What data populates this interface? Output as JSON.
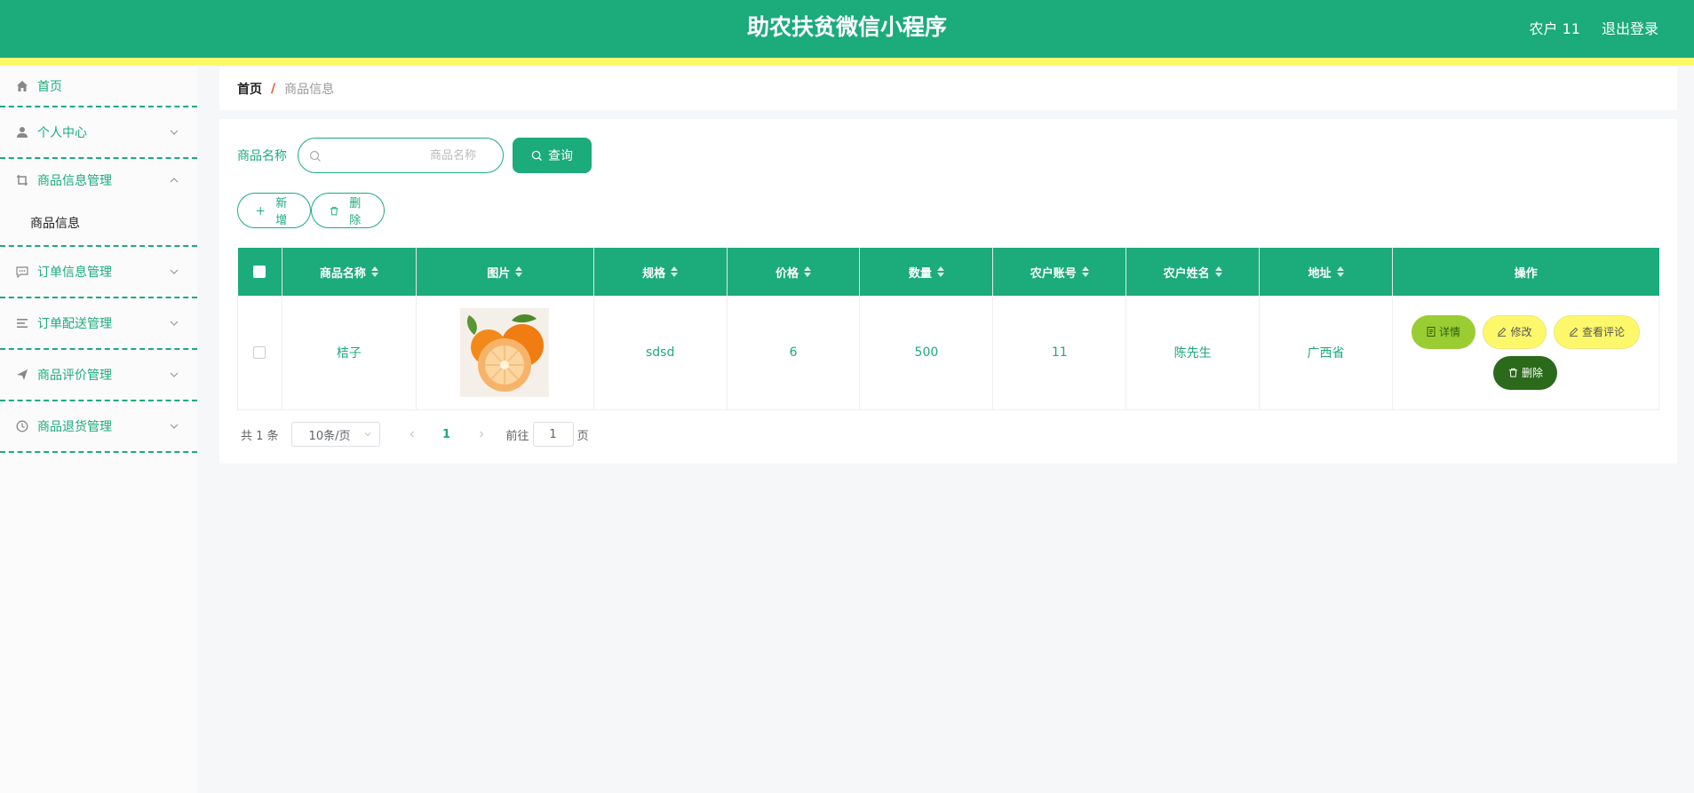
{
  "header": {
    "title": "助农扶贫微信小程序",
    "user": "农户 11",
    "logout": "退出登录",
    "colors": {
      "primary": "#1cab7a",
      "accent": "#fdf86a"
    }
  },
  "sidebar": {
    "items": [
      {
        "label": "首页",
        "icon": "home-icon"
      },
      {
        "label": "个人中心",
        "icon": "user-icon"
      },
      {
        "label": "商品信息管理",
        "icon": "crop-icon",
        "expanded": true,
        "children": [
          {
            "label": "商品信息"
          }
        ]
      },
      {
        "label": "订单信息管理",
        "icon": "chat-icon"
      },
      {
        "label": "订单配送管理",
        "icon": "list-icon"
      },
      {
        "label": "商品评价管理",
        "icon": "send-icon"
      },
      {
        "label": "商品退货管理",
        "icon": "clock-icon"
      }
    ]
  },
  "breadcrumb": {
    "home": "首页",
    "separator": "/",
    "current": "商品信息"
  },
  "search": {
    "label": "商品名称",
    "placeholder": "商品名称",
    "value": "",
    "button": "查询"
  },
  "actions": {
    "add": "新增",
    "delete": "删除"
  },
  "table": {
    "columns": [
      "商品名称",
      "图片",
      "规格",
      "价格",
      "数量",
      "农户账号",
      "农户姓名",
      "地址",
      "操作"
    ],
    "rows": [
      {
        "name": "桔子",
        "spec": "sdsd",
        "price": "6",
        "quantity": "500",
        "account": "11",
        "farmer": "陈先生",
        "address": "广西省"
      }
    ],
    "row_actions": {
      "detail": "详情",
      "edit": "修改",
      "review": "查看评论",
      "delete": "删除"
    }
  },
  "pagination": {
    "total": "共 1 条",
    "page_size": "10条/页",
    "current_page": "1",
    "goto_label": "前往",
    "goto_value": "1",
    "page_suffix": "页"
  }
}
